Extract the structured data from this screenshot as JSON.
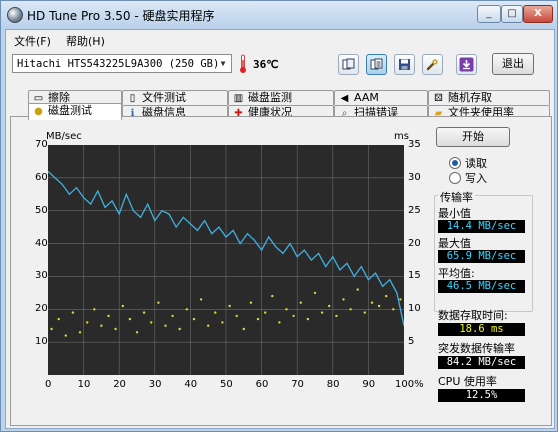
{
  "window": {
    "title": "HD Tune Pro 3.50 - 硬盘实用程序",
    "controls": {
      "minimize": "_",
      "maximize": "□",
      "close": "X"
    }
  },
  "menu": {
    "file": "文件(F)",
    "help": "帮助(H)"
  },
  "toolbar": {
    "drive": "Hitachi HTS543225L9A300 (250 GB)",
    "temperature": "36℃",
    "exit_label": "退出",
    "icons": [
      "copy-icon",
      "copy-text-icon",
      "save-icon",
      "tools-icon",
      "download-icon"
    ]
  },
  "tabs": {
    "row1": [
      "擦除",
      "文件测试",
      "磁盘监测",
      "AAM",
      "随机存取"
    ],
    "row2": [
      "磁盘测试",
      "磁盘信息",
      "健康状况",
      "扫描错误",
      "文件夹使用率"
    ],
    "selected": "磁盘测试"
  },
  "controls": {
    "start_label": "开始",
    "read_label": "读取",
    "write_label": "写入",
    "mode": "read"
  },
  "stats": {
    "transfer_rate_label": "传输率",
    "min_label": "最小值",
    "min_value": "14.4 MB/sec",
    "max_label": "最大值",
    "max_value": "65.9 MB/sec",
    "avg_label": "平均值:",
    "avg_value": "46.5 MB/sec",
    "access_time_label": "数据存取时间:",
    "access_time_value": "18.6 ms",
    "burst_label": "突发数据传输率",
    "burst_value": "84.2 MB/sec",
    "cpu_label": "CPU 使用率",
    "cpu_value": "12.5%"
  },
  "chart_data": {
    "type": "line",
    "left_unit": "MB/sec",
    "right_unit": "ms",
    "ylim_left": [
      0,
      70
    ],
    "ylim_right": [
      0,
      35
    ],
    "xlim": [
      0,
      100
    ],
    "y_ticks_left": [
      "70",
      "60",
      "50",
      "40",
      "30",
      "20",
      "10"
    ],
    "y_ticks_right": [
      "35",
      "30",
      "25",
      "20",
      "15",
      "10",
      "5"
    ],
    "x_ticks": [
      "0",
      "10",
      "20",
      "30",
      "40",
      "50",
      "60",
      "70",
      "80",
      "90",
      "100%"
    ],
    "grid": true,
    "series": [
      {
        "color": "#3fb0e0",
        "x": [
          0,
          2,
          4,
          6,
          8,
          10,
          12,
          14,
          16,
          18,
          20,
          22,
          24,
          26,
          28,
          30,
          32,
          34,
          36,
          38,
          40,
          42,
          44,
          46,
          48,
          50,
          52,
          54,
          56,
          58,
          60,
          62,
          64,
          66,
          68,
          70,
          72,
          74,
          76,
          78,
          80,
          82,
          84,
          86,
          88,
          90,
          92,
          94,
          96,
          98,
          100
        ],
        "y": [
          62,
          60,
          58,
          55,
          57,
          54,
          52,
          56,
          51,
          53,
          49,
          55,
          50,
          48,
          52,
          47,
          50,
          49,
          45,
          48,
          46,
          44,
          47,
          43,
          45,
          42,
          44,
          40,
          43,
          41,
          38,
          42,
          39,
          37,
          40,
          36,
          38,
          35,
          37,
          33,
          36,
          32,
          34,
          30,
          33,
          29,
          31,
          27,
          29,
          25,
          15
        ]
      },
      {
        "color": "#d8d83a",
        "x": [
          1,
          3,
          5,
          7,
          9,
          11,
          13,
          15,
          17,
          19,
          21,
          23,
          25,
          27,
          29,
          31,
          33,
          35,
          37,
          39,
          41,
          43,
          45,
          47,
          49,
          51,
          53,
          55,
          57,
          59,
          61,
          63,
          65,
          67,
          69,
          71,
          73,
          75,
          77,
          79,
          81,
          83,
          85,
          87,
          89,
          91,
          93,
          95,
          97,
          99
        ],
        "y": [
          14,
          17,
          12,
          19,
          13,
          16,
          20,
          15,
          18,
          14,
          21,
          17,
          13,
          19,
          16,
          22,
          15,
          18,
          14,
          20,
          17,
          23,
          15,
          19,
          16,
          21,
          18,
          14,
          22,
          17,
          19,
          24,
          16,
          20,
          18,
          22,
          17,
          25,
          19,
          21,
          18,
          23,
          20,
          26,
          19,
          22,
          21,
          24,
          20,
          23
        ]
      }
    ]
  }
}
